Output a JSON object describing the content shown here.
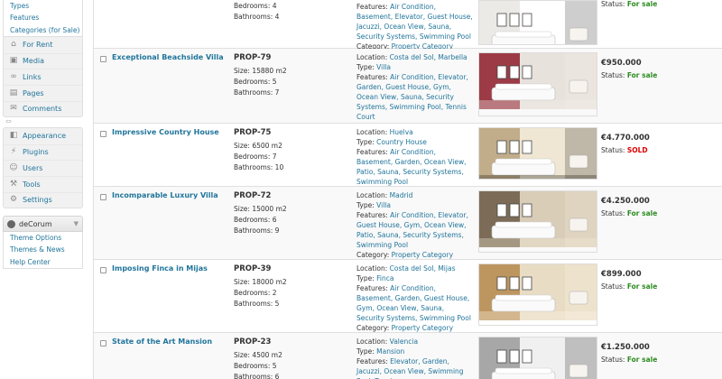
{
  "sidebar": {
    "top_submenu": [
      "Types",
      "Features",
      "Categories (for Sale)"
    ],
    "menu_group_1": [
      {
        "label": "For Rent",
        "icon": "house-icon"
      },
      {
        "label": "Media",
        "icon": "media-icon"
      },
      {
        "label": "Links",
        "icon": "links-icon"
      },
      {
        "label": "Pages",
        "icon": "pages-icon"
      },
      {
        "label": "Comments",
        "icon": "comments-icon"
      }
    ],
    "menu_group_2": [
      {
        "label": "Appearance",
        "icon": "appearance-icon"
      },
      {
        "label": "Plugins",
        "icon": "plugins-icon"
      },
      {
        "label": "Users",
        "icon": "users-icon"
      },
      {
        "label": "Tools",
        "icon": "tools-icon"
      },
      {
        "label": "Settings",
        "icon": "settings-icon"
      }
    ],
    "decorum": {
      "title": "deCorum",
      "items": [
        "Theme Options",
        "Themes & News",
        "Help Center"
      ]
    }
  },
  "labels": {
    "size": "Size:",
    "bedrooms": "Bedrooms:",
    "bathrooms": "Bathrooms:",
    "location": "Location:",
    "type": "Type:",
    "features": "Features:",
    "category": "Category:",
    "status": "Status:"
  },
  "properties": [
    {
      "title": "",
      "ref": "",
      "size": "",
      "bedrooms": "4",
      "bathrooms": "4",
      "location": "",
      "type": "",
      "features": "Air Condition, Basement, Elevator, Guest House, Jacuzzi, Ocean View, Sauna, Security Systems, Swimming Pool",
      "category": "Property Category",
      "price": "",
      "status": "For sale",
      "status_kind": "sale",
      "room_colors": [
        "#e9e6e2",
        "#ffffff",
        "#3a3a3a"
      ]
    },
    {
      "title": "Exceptional Beachside Villa",
      "ref": "PROP-79",
      "size": "15880 m2",
      "bedrooms": "5",
      "bathrooms": "7",
      "location": "Costa del Sol, Marbella",
      "type": "Villa",
      "features": "Air Condition, Elevator, Garden, Guest House, Gym, Ocean View, Sauna, Security Systems, Swimming Pool, Tennis Court",
      "category": "Property Category",
      "price": "€950.000",
      "status": "For sale",
      "status_kind": "sale",
      "room_colors": [
        "#8e1d2b",
        "#e8e2dc",
        "#f2efe9"
      ]
    },
    {
      "title": "Impressive Country House",
      "ref": "PROP-75",
      "size": "6500 m2",
      "bedrooms": "7",
      "bathrooms": "10",
      "location": "Huelva",
      "type": "Country House",
      "features": "Air Condition, Basement, Garden, Ocean View, Patio, Sauna, Security Systems, Swimming Pool",
      "category": "Property Category",
      "price": "€4.770.000",
      "status": "SOLD",
      "status_kind": "sold",
      "room_colors": [
        "#b8a27c",
        "#efe6d3",
        "#2f2a25"
      ]
    },
    {
      "title": "Incomparable Luxury Villa",
      "ref": "PROP-72",
      "size": "15000 m2",
      "bedrooms": "6",
      "bathrooms": "9",
      "location": "Madrid",
      "type": "Villa",
      "features": "Air Condition, Elevator, Guest House, Gym, Ocean View, Patio, Sauna, Security Systems, Swimming Pool",
      "category": "Property Category",
      "price": "€4.250.000",
      "status": "For sale",
      "status_kind": "sale",
      "room_colors": [
        "#6b5a45",
        "#d9cdb8",
        "#f4ead8"
      ]
    },
    {
      "title": "Imposing Finca in Mijas",
      "ref": "PROP-39",
      "size": "18000 m2",
      "bedrooms": "2",
      "bathrooms": "5",
      "location": "Costa del Sol, Mijas",
      "type": "Finca",
      "features": "Air Condition, Basement, Garden, Guest House, Gym, Ocean View, Sauna, Security Systems, Swimming Pool",
      "category": "Property Category",
      "price": "€899.000",
      "status": "For sale",
      "status_kind": "sale",
      "room_colors": [
        "#b58a4e",
        "#e9dcc4",
        "#fbf3e4"
      ]
    },
    {
      "title": "State of the Art Mansion",
      "ref": "PROP-23",
      "size": "4500 m2",
      "bedrooms": "5",
      "bathrooms": "6",
      "location": "Valencia",
      "type": "Mansion",
      "features": "Elevator, Garden, Jacuzzi, Ocean View, Swimming Pool, Tennis",
      "category": "",
      "price": "€1.250.000",
      "status": "For sale",
      "status_kind": "sale",
      "room_colors": [
        "#9a9a9a",
        "#f0f0f0",
        "#2a2a2a"
      ]
    }
  ]
}
